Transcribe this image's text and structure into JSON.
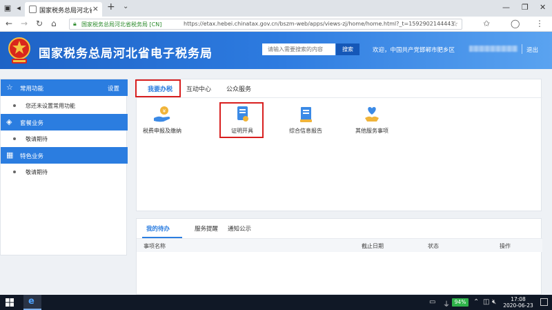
{
  "browser": {
    "tab_title": "国家税务总局河北省电子",
    "url_cert": "国家税务总局河北省税务局 [CN]",
    "url": "https://etax.hebei.chinatax.gov.cn/bszm-web/apps/views-zj/home/home.html?_t=1592902144443"
  },
  "header": {
    "title": "国家税务总局河北省电子税务局",
    "search_placeholder": "请输入需要搜索的内容",
    "search_button": "搜索",
    "welcome": "欢迎，中国共产党邯郸市肥乡区",
    "logout": "退出"
  },
  "sidebar": {
    "sections": [
      {
        "label": "常用功能",
        "setting": "设置",
        "icon": "star-icon",
        "items": [
          "您还未设置常用功能"
        ]
      },
      {
        "label": "套餐业务",
        "icon": "layers-icon",
        "items": [
          "敬请期待"
        ]
      },
      {
        "label": "特色业务",
        "icon": "grid-icon",
        "items": [
          "敬请期待"
        ]
      }
    ]
  },
  "main": {
    "tabs": [
      "我要办税",
      "互动中心",
      "公众服务"
    ],
    "active_tab": 0,
    "services": [
      {
        "label": "税费申报及缴纳",
        "icon": "hand-coin-icon"
      },
      {
        "label": "证明开具",
        "icon": "certificate-icon"
      },
      {
        "label": "综合信息报告",
        "icon": "report-book-icon"
      },
      {
        "label": "其他服务事项",
        "icon": "heart-hand-icon"
      }
    ]
  },
  "todo": {
    "tabs": [
      "我的待办",
      "服务提醒",
      "通知公示"
    ],
    "columns": [
      "事项名称",
      "截止日期",
      "状态",
      "操作"
    ]
  },
  "taskbar": {
    "battery": "94%",
    "time": "17:08",
    "date": "2020-06-23"
  },
  "colors": {
    "brand_blue": "#2b7de0",
    "highlight_red": "#d81e1e"
  }
}
